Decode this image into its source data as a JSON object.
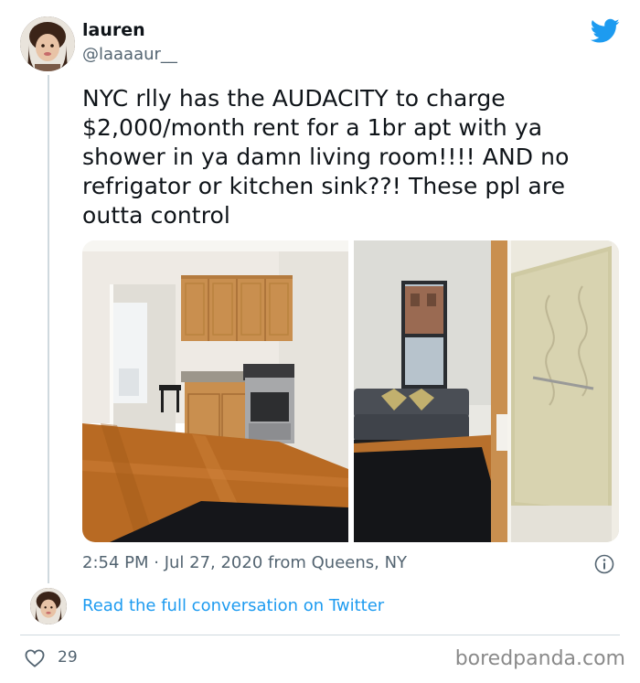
{
  "tweet": {
    "display_name": "lauren",
    "handle": "@laaaaur__",
    "text": "NYC rlly has the AUDACITY to charge $2,000/month rent for a 1br apt with ya shower in ya damn living room!!!! AND no refrigator or kitchen sink??! These ppl are outta control",
    "timestamp": "2:54 PM · Jul 27, 2020 from Queens, NY",
    "read_conversation_label": "Read the full conversation on Twitter",
    "like_count": "29"
  },
  "icons": {
    "brand": "twitter-bird-icon",
    "info": "info-icon",
    "like": "heart-icon"
  },
  "colors": {
    "link": "#1d9bf0",
    "brand": "#1d9bf0",
    "secondary_text": "#536471",
    "divider": "#cfd9de"
  },
  "watermark": "boredpanda.com"
}
